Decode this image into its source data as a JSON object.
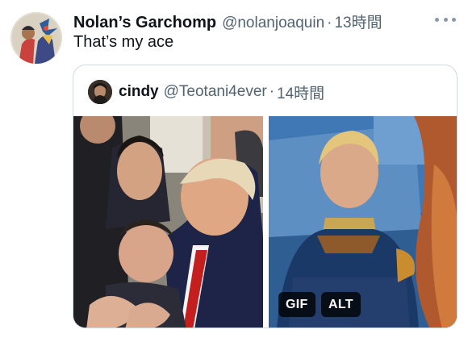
{
  "tweet": {
    "display_name": "Nolan’s Garchomp",
    "handle": "@nolanjoaquin",
    "separator": "·",
    "time": "13時間",
    "text": "That’s my ace",
    "more_icon": "more-horizontal-icon"
  },
  "quote": {
    "display_name": "cindy",
    "handle": "@Teotani4ever",
    "separator": "·",
    "time": "14時間",
    "media": [
      {
        "kind": "photo"
      },
      {
        "kind": "gif",
        "badges": {
          "gif": "GIF",
          "alt": "ALT"
        }
      }
    ]
  },
  "colors": {
    "text_primary": "#0f1419",
    "text_secondary": "#536471",
    "border": "#cfd9de",
    "badge_bg": "#000000"
  }
}
